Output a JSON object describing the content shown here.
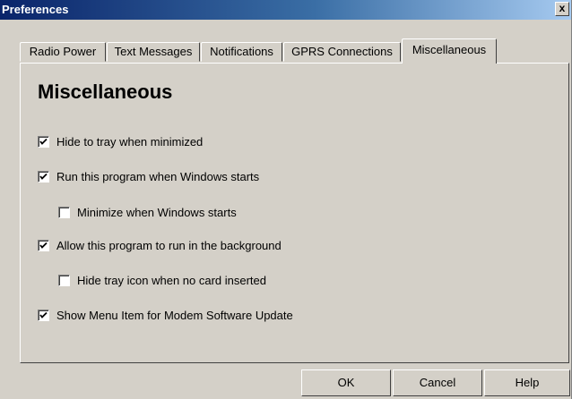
{
  "window": {
    "title": "Preferences",
    "close_label": "x"
  },
  "tabs": [
    {
      "label": "Radio Power",
      "active": false
    },
    {
      "label": "Text Messages",
      "active": false
    },
    {
      "label": "Notifications",
      "active": false
    },
    {
      "label": "GPRS Connections",
      "active": false
    },
    {
      "label": "Miscellaneous",
      "active": true
    }
  ],
  "main": {
    "heading": "Miscellaneous",
    "options": [
      {
        "label": "Hide to tray when minimized",
        "checked": true
      },
      {
        "label": "Run this program when Windows starts",
        "checked": true
      },
      {
        "label": "Minimize when Windows starts",
        "checked": false
      },
      {
        "label": "Allow this program to run in the background",
        "checked": true
      },
      {
        "label": "Hide tray icon when no card inserted",
        "checked": false
      },
      {
        "label": "Show Menu Item for Modem Software Update",
        "checked": true
      }
    ]
  },
  "buttons": {
    "ok": "OK",
    "cancel": "Cancel",
    "help": "Help"
  }
}
